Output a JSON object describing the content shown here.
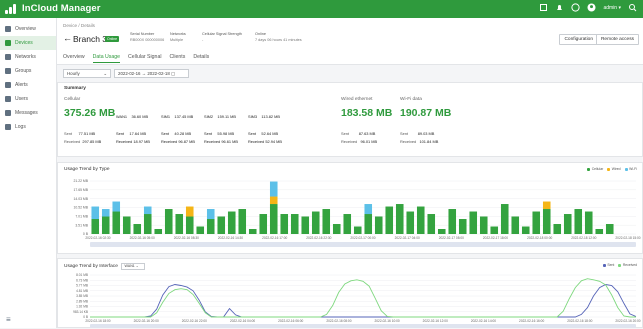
{
  "app": {
    "name": "InCloud Manager"
  },
  "top": {
    "user": "admin ▾",
    "help": "?"
  },
  "sidebar": {
    "items": [
      {
        "label": "Overview",
        "icon": "dashboard-icon"
      },
      {
        "label": "Devices",
        "icon": "device-icon",
        "active": true
      },
      {
        "label": "Networks",
        "icon": "network-icon"
      },
      {
        "label": "Groups",
        "icon": "group-icon"
      },
      {
        "label": "Alerts",
        "icon": "bell-icon"
      },
      {
        "label": "Users",
        "icon": "user-icon"
      },
      {
        "label": "Messages",
        "icon": "message-icon"
      },
      {
        "label": "Logs",
        "icon": "log-icon"
      }
    ],
    "collapse": "≡"
  },
  "header": {
    "breadcrumb": "Device / Details",
    "back": "←",
    "title": "Branch 3",
    "status": "Online",
    "meta": [
      {
        "k": "Serial Number",
        "v": "RB000X 000000006"
      },
      {
        "k": "Networks",
        "v": "Multiple"
      },
      {
        "k": "Cellular Signal Strength",
        "v": "-"
      },
      {
        "k": "Online",
        "v": "7 days 06 hours 41 minutes"
      }
    ],
    "buttons": [
      "Configuration",
      "Remote access"
    ],
    "tabs": [
      "Overview",
      "Data Usage",
      "Cellular Signal",
      "Clients",
      "Details"
    ],
    "active_tab": 1
  },
  "filters": {
    "period": "Hourly",
    "range_start": "2022-02-16",
    "range_end": "2022-02-18"
  },
  "summary": {
    "title": "Summary",
    "cellular": {
      "label": "Cellular",
      "total": "375.26 MB",
      "cols": [
        {
          "name": "WAN1",
          "total": "36.60 MB",
          "sent_l": "Sent",
          "sent": "17.64 MB",
          "rec_l": "Received",
          "rec": "18.97 MB"
        },
        {
          "name": "SIM1",
          "total": "137.45 MB",
          "sent_l": "Sent",
          "sent": "40.28 MB",
          "rec_l": "Received",
          "rec": "96.87 MB"
        },
        {
          "name": "SIM2",
          "total": "159.11 MB",
          "sent_l": "Sent",
          "sent": "55.98 MB",
          "rec_l": "Received",
          "rec": "96.61 MB"
        },
        {
          "name": "SIM3",
          "total": "113.82 MB",
          "sent_l": "Sent",
          "sent": "52.64 MB",
          "rec_l": "Received",
          "rec": "52.94 MB"
        }
      ],
      "first": {
        "sent": "77.51 MB",
        "rec": "297.85 MB"
      }
    },
    "wired": {
      "label": "Wired ethernet",
      "total": "183.58 MB",
      "sent": "87.63 MB",
      "rec": "96.01 MB"
    },
    "wifi": {
      "label": "Wi-Fi data",
      "total": "190.87 MB",
      "sent": "89.03 MB",
      "rec": "101.84 MB"
    }
  },
  "chart1": {
    "title": "Usage Trend by Type",
    "legend": [
      "Cellular",
      "Wired",
      "Wi-Fi"
    ],
    "colors": {
      "Cellular": "#34a33f",
      "Wired": "#f5b516",
      "Wi-Fi": "#5cc0e8"
    }
  },
  "chart2": {
    "title": "Usage Trend by Interface",
    "select": "WAN1",
    "legend": [
      "Sent",
      "Received"
    ],
    "colors": {
      "Sent": "#5664b8",
      "Received": "#7fd87f"
    }
  },
  "chart_data": [
    {
      "type": "bar",
      "title": "Usage Trend by Type",
      "stacked": true,
      "yticks": [
        "21.22 MB",
        "17.65 MB",
        "14.03 MB",
        "10.52 MB",
        "7.01 MB",
        "3.51 MB",
        "0 B"
      ],
      "ylim": [
        0,
        21.22
      ],
      "xticks": [
        "2022-02-16 02:30",
        "2022-02-16 05:00",
        "2022-02-16 08:30",
        "2022-02-16 14:30",
        "2022-02-16 17:00",
        "2022-02-16 22:30",
        "2022-02-17 00:00",
        "2022-02-17 04:00",
        "2022-02-17 08:00",
        "2022-02-17 18:00",
        "2022-02-18 00:00",
        "2022-02-18 12:00",
        "2022-02-18 15:00"
      ],
      "series": [
        {
          "name": "Cellular",
          "values": [
            6,
            7,
            9,
            7,
            4,
            8,
            2,
            10,
            8,
            7,
            3,
            6,
            7,
            9,
            10,
            2,
            8,
            12,
            8,
            8,
            7,
            9,
            10,
            4,
            8,
            3,
            8,
            7,
            11,
            12,
            9,
            11,
            8,
            2,
            10,
            6,
            9,
            7,
            3,
            12,
            7,
            3,
            9,
            10,
            4,
            8,
            10,
            9,
            2,
            4,
            0,
            0
          ]
        },
        {
          "name": "Wired",
          "values": [
            0,
            0,
            0,
            0,
            0,
            0,
            0,
            0,
            0,
            4,
            0,
            0,
            0,
            0,
            0,
            0,
            0,
            3,
            0,
            0,
            0,
            0,
            0,
            0,
            0,
            0,
            0,
            0,
            0,
            0,
            0,
            0,
            0,
            0,
            0,
            0,
            0,
            0,
            0,
            0,
            0,
            0,
            0,
            3,
            0,
            0,
            0,
            0,
            0,
            0,
            0,
            0
          ]
        },
        {
          "name": "Wi-Fi",
          "values": [
            5,
            3,
            4,
            0,
            0,
            3,
            0,
            0,
            0,
            0,
            0,
            4,
            0,
            0,
            0,
            0,
            0,
            6,
            0,
            0,
            0,
            0,
            0,
            0,
            0,
            0,
            4,
            0,
            0,
            0,
            0,
            0,
            0,
            0,
            0,
            0,
            0,
            0,
            0,
            0,
            0,
            0,
            0,
            0,
            0,
            0,
            0,
            0,
            0,
            0,
            0,
            0
          ]
        }
      ]
    },
    {
      "type": "line",
      "title": "Usage Trend by Interface",
      "yticks": [
        "8.01 MB",
        "6.73 MB",
        "5.77 MB",
        "4.81 MB",
        "3.85 MB",
        "2.89 MB",
        "1.92 MB",
        "983.14 KB",
        "0 B"
      ],
      "ylim": [
        0,
        8.01
      ],
      "xticks": [
        "2022-02-16 18:00",
        "2022-02-16 20:00",
        "2022-02-16 22:00",
        "2022-02-16 04:00",
        "2022-02-16 06:00",
        "2022-02-16 08:00",
        "2022-02-16 10:00",
        "2022-02-16 12:00",
        "2022-02-16 14:00",
        "2022-02-16 16:00",
        "2022-02-16 18:00",
        "2022-02-16 20:00"
      ],
      "series": [
        {
          "name": "Sent",
          "values": [
            0,
            0,
            0,
            0,
            0,
            0,
            0,
            0,
            0,
            0,
            0.2,
            1.5,
            4.2,
            5.8,
            6.2,
            6.0,
            5.7,
            5.0,
            3.2,
            1.0,
            0.1,
            0,
            0,
            1.6,
            0.4,
            0,
            0,
            0,
            0,
            0,
            0,
            0,
            0,
            0,
            0,
            0,
            0,
            0,
            0,
            0,
            0,
            0,
            0,
            0,
            0,
            0,
            0,
            0,
            0,
            0,
            0,
            0,
            0,
            0,
            0,
            0,
            0,
            0,
            0,
            0,
            0,
            0,
            0,
            0,
            0,
            0,
            0,
            0,
            0,
            0,
            0,
            0,
            0,
            0,
            0,
            0,
            0,
            0,
            0,
            0,
            0,
            0.5,
            1.8,
            4.0,
            5.6,
            6.2,
            6.0,
            4.8,
            2.6,
            0.6,
            0.1
          ]
        },
        {
          "name": "Received",
          "values": [
            0,
            0,
            0,
            0,
            0,
            0,
            0,
            0,
            0,
            0,
            0,
            0.8,
            2.8,
            4.5,
            5.2,
            5.4,
            5.2,
            4.3,
            2.6,
            0.8,
            0,
            0,
            0,
            0,
            0,
            0,
            0,
            0,
            0,
            0,
            0,
            0,
            0,
            0,
            0,
            0,
            0,
            0,
            0,
            0.5,
            2.2,
            4.7,
            6.3,
            6.9,
            7.1,
            6.8,
            5.9,
            3.6,
            1.2,
            0.1,
            0,
            0,
            0,
            0,
            0,
            0,
            0,
            0,
            0,
            0,
            0,
            0,
            0,
            0,
            0,
            0,
            0,
            0,
            0,
            0,
            0,
            0,
            0,
            0,
            0,
            0,
            0,
            0,
            1.1,
            3.5,
            5.6,
            6.9,
            7.3,
            7.1,
            6.8,
            6.1,
            4.2,
            1.8,
            0.2,
            0,
            0
          ]
        }
      ]
    }
  ]
}
